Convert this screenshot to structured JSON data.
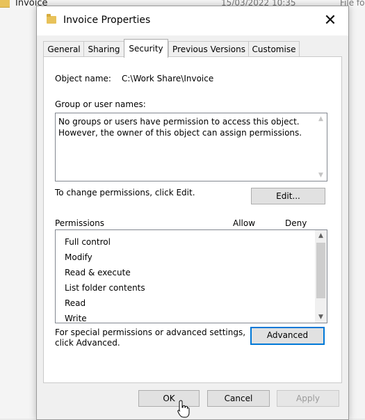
{
  "background": {
    "file_name": "Invoice",
    "date_modified": "15/03/2022 10:35",
    "type_partial": "File fo"
  },
  "dialog": {
    "title": "Invoice Properties",
    "close_glyph": "✕",
    "tabs": [
      "General",
      "Sharing",
      "Security",
      "Previous Versions",
      "Customise"
    ],
    "active_tab": "Security"
  },
  "security": {
    "object_name_label": "Object name:",
    "object_name_value": "C:\\Work Share\\Invoice",
    "group_label": "Group or user names:",
    "group_message_line1": "No groups or users have permission to access this object.",
    "group_message_line2": "However, the owner of this object can assign permissions.",
    "change_text": "To change permissions, click Edit.",
    "edit_button": "Edit...",
    "permissions_label": "Permissions",
    "allow_label": "Allow",
    "deny_label": "Deny",
    "permissions": [
      "Full control",
      "Modify",
      "Read & execute",
      "List folder contents",
      "Read",
      "Write"
    ],
    "special_line1": "For special permissions or advanced settings,",
    "special_line2": "click Advanced.",
    "advanced_button": "Advanced"
  },
  "footer": {
    "ok_button": "OK",
    "cancel_button": "Cancel",
    "apply_button": "Apply"
  },
  "icons": {
    "scroll_up": "▲",
    "scroll_down": "▼"
  }
}
